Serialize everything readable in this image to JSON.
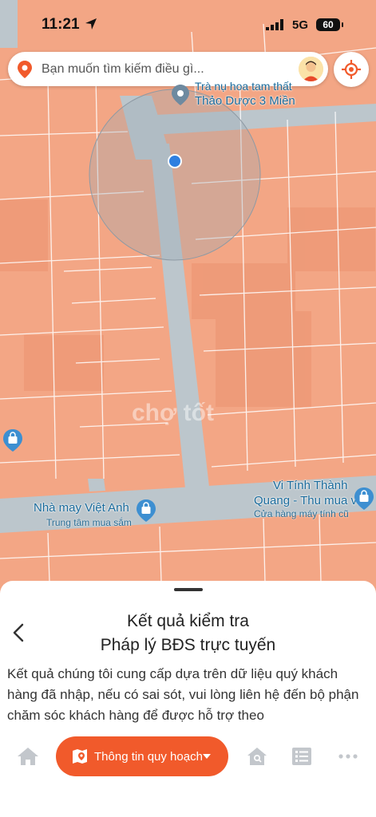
{
  "status_bar": {
    "time": "11:21",
    "network": "5G",
    "battery": "60"
  },
  "search": {
    "placeholder": "Bạn muốn tìm kiếm điều gì..."
  },
  "map_labels": {
    "shop_name_1": "Trà nụ hoa tam thất",
    "shop_name_2": "Thảo Dược 3 Miền",
    "tailor": "Nhà may Việt Anh",
    "tailor_category": "Trung tâm mua sắm",
    "computer_shop_1": "Vi Tính Thành",
    "computer_shop_2": "Quang - Thu mua vi...",
    "computer_shop_category": "Cửa hàng máy tính cũ",
    "watermark": "chợ tốt"
  },
  "sheet": {
    "title_line1": "Kết quả kiểm tra",
    "title_line2": "Pháp lý BĐS trực tuyến",
    "body": "Kết quả chúng tôi cung cấp dựa trên dữ liệu quý khách hàng đã nhập, nếu có sai sót, vui lòng liên hệ đến bộ phận chăm sóc khách hàng để được hỗ trợ theo"
  },
  "bottom_nav": {
    "plan_label": "Thông tin quy hoạch",
    "icons": [
      "home-icon",
      "map-plan-icon",
      "house-search-icon",
      "list-icon",
      "more-icon"
    ]
  },
  "colors": {
    "accent": "#f15a2b",
    "parcel": "#f3a685",
    "road": "#b9c4ca",
    "map_text": "#1a6b9c"
  }
}
